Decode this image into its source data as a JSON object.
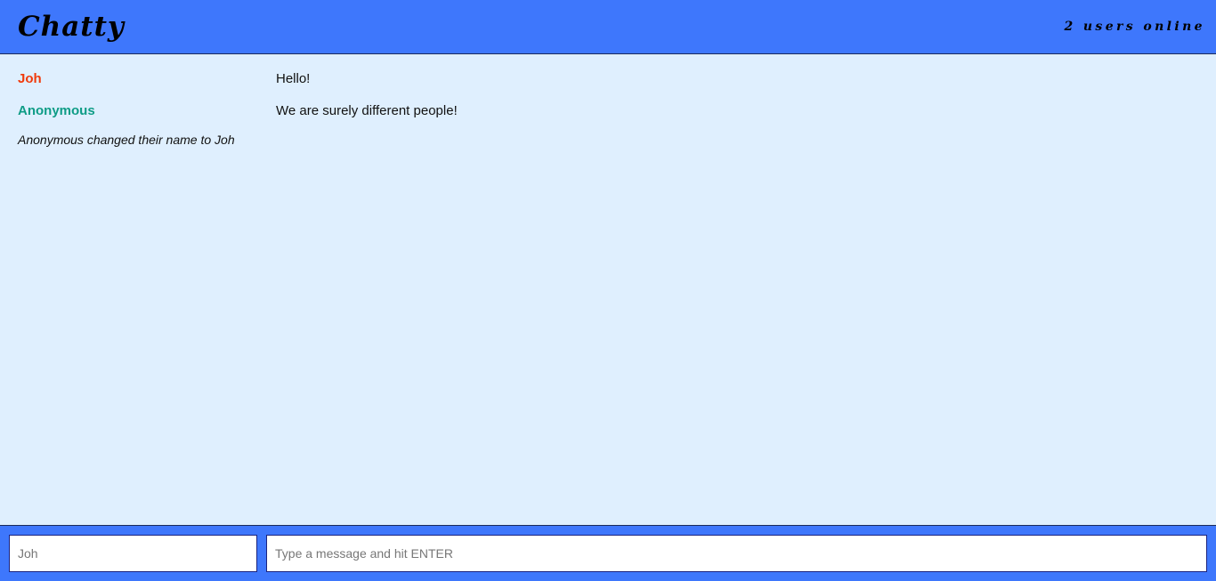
{
  "navbar": {
    "brand": "Chatty",
    "users_online": "2 users online"
  },
  "messages": [
    {
      "type": "message",
      "username": "Joh",
      "username_color": "#f03a0c",
      "content": "Hello!"
    },
    {
      "type": "message",
      "username": "Anonymous",
      "username_color": "#0e9c86",
      "content": "We are surely different people!"
    },
    {
      "type": "notification",
      "content": "Anonymous changed their name to Joh"
    }
  ],
  "composer": {
    "username_placeholder": "Joh",
    "message_placeholder": "Type a message and hit ENTER"
  },
  "colors": {
    "navbar_bg": "#3e77fc",
    "page_bg": "#dfeffe"
  }
}
